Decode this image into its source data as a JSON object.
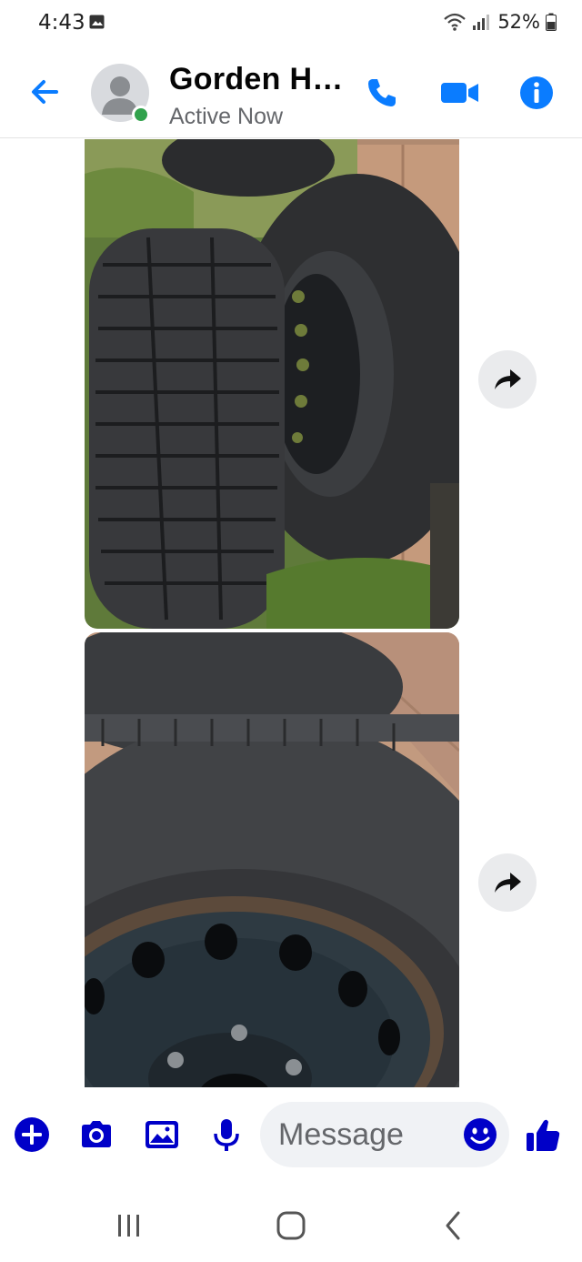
{
  "status_bar": {
    "time": "4:43",
    "battery": "52%"
  },
  "header": {
    "contact_name": "Gorden H…",
    "presence": "Active Now"
  },
  "composer": {
    "placeholder": "Message"
  },
  "colors": {
    "accent": "#0a7cff",
    "composer_icons": "#0000c8",
    "online": "#31a24c"
  },
  "icons": [
    "back-arrow-icon",
    "phone-icon",
    "video-camera-icon",
    "info-icon",
    "share-icon",
    "plus-icon",
    "camera-icon",
    "gallery-icon",
    "microphone-icon",
    "emoji-icon",
    "thumbs-up-icon",
    "recent-apps-icon",
    "home-icon",
    "back-icon"
  ]
}
